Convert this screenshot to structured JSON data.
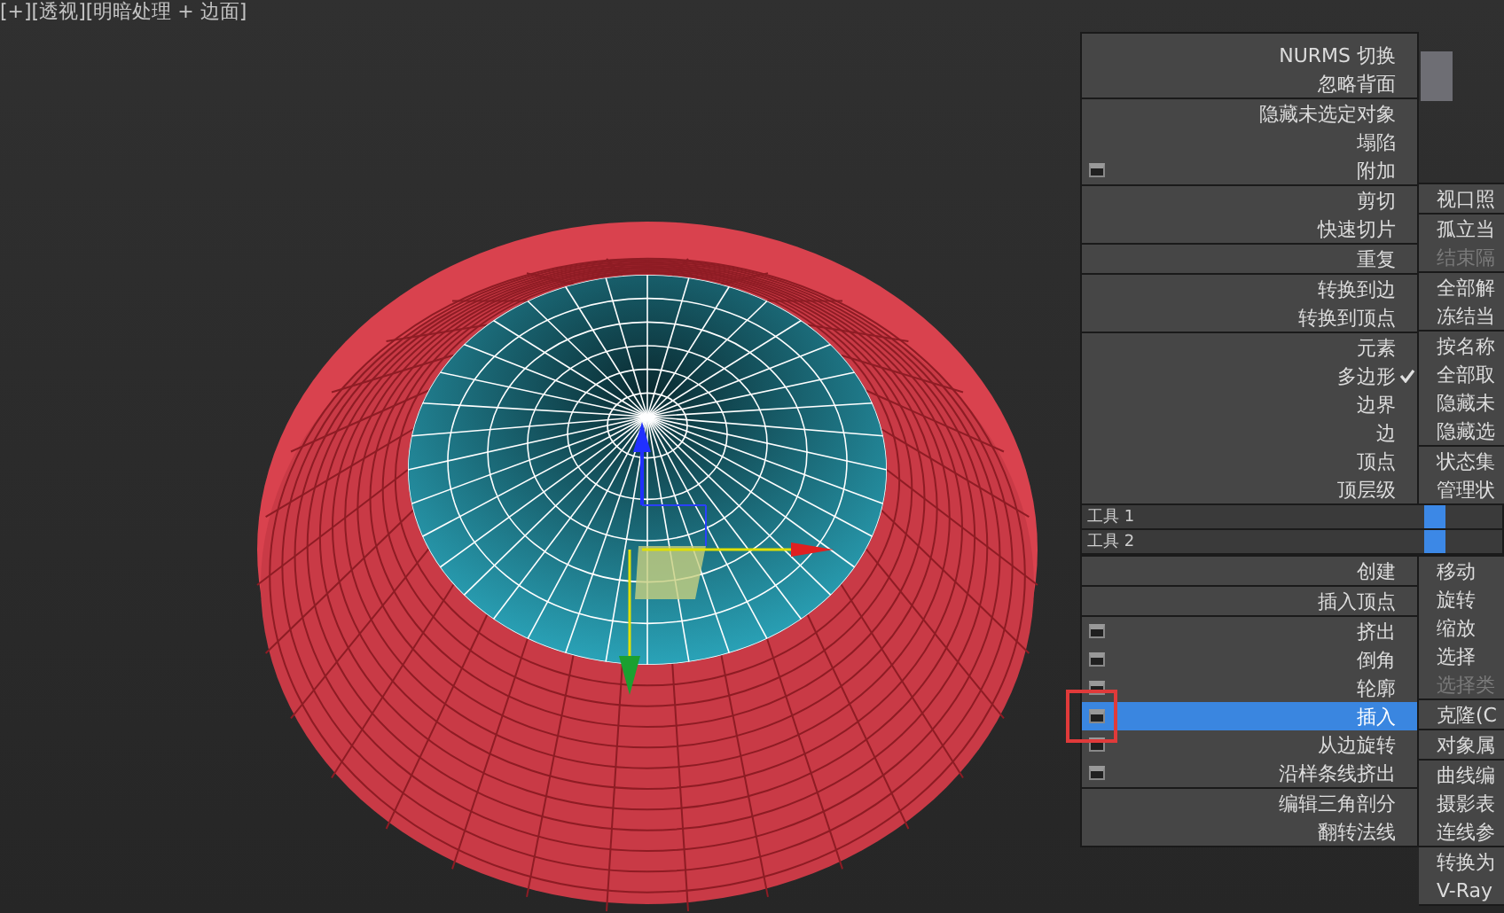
{
  "viewport": {
    "label": "[+][透视][明暗处理 + 边面]"
  },
  "quad_menu": {
    "left_top_groups": [
      {
        "items": [
          {
            "label": "NURMS 切换",
            "has_settings": false,
            "checked": false,
            "selected": false,
            "marked": false
          },
          {
            "label": "忽略背面",
            "has_settings": false,
            "checked": false,
            "selected": false,
            "marked": false
          }
        ]
      },
      {
        "items": [
          {
            "label": "隐藏未选定对象",
            "has_settings": false,
            "checked": false,
            "selected": false,
            "marked": false
          },
          {
            "label": "塌陷",
            "has_settings": false,
            "checked": false,
            "selected": false,
            "marked": false
          },
          {
            "label": "附加",
            "has_settings": true,
            "checked": false,
            "selected": false,
            "marked": false
          }
        ]
      },
      {
        "items": [
          {
            "label": "剪切",
            "has_settings": false,
            "checked": false,
            "selected": false,
            "marked": false
          },
          {
            "label": "快速切片",
            "has_settings": false,
            "checked": false,
            "selected": false,
            "marked": false
          }
        ]
      },
      {
        "items": [
          {
            "label": "重复",
            "has_settings": false,
            "checked": false,
            "selected": false,
            "marked": false
          }
        ]
      },
      {
        "items": [
          {
            "label": "转换到边",
            "has_settings": false,
            "checked": false,
            "selected": false,
            "marked": false
          },
          {
            "label": "转换到顶点",
            "has_settings": false,
            "checked": false,
            "selected": false,
            "marked": false
          }
        ]
      },
      {
        "items": [
          {
            "label": "元素",
            "has_settings": false,
            "checked": false,
            "selected": false,
            "marked": false
          },
          {
            "label": "多边形",
            "has_settings": false,
            "checked": true,
            "selected": false,
            "marked": false
          },
          {
            "label": "边界",
            "has_settings": false,
            "checked": false,
            "selected": false,
            "marked": false
          },
          {
            "label": "边",
            "has_settings": false,
            "checked": false,
            "selected": false,
            "marked": false
          },
          {
            "label": "顶点",
            "has_settings": false,
            "checked": false,
            "selected": false,
            "marked": false
          },
          {
            "label": "顶层级",
            "has_settings": false,
            "checked": false,
            "selected": false,
            "marked": false
          }
        ]
      }
    ],
    "right_top_groups": [
      {
        "items": [
          {
            "label": "视口照",
            "disabled": false
          }
        ]
      },
      {
        "items": [
          {
            "label": "孤立当",
            "disabled": false
          },
          {
            "label": "结束隔",
            "disabled": true
          }
        ]
      },
      {
        "items": [
          {
            "label": "全部解",
            "disabled": false
          },
          {
            "label": "冻结当",
            "disabled": false
          }
        ]
      },
      {
        "items": [
          {
            "label": "按名称",
            "disabled": false
          },
          {
            "label": "全部取",
            "disabled": false
          },
          {
            "label": "隐藏未",
            "disabled": false
          },
          {
            "label": "隐藏选",
            "disabled": false
          }
        ]
      },
      {
        "items": [
          {
            "label": "状态集",
            "disabled": false
          },
          {
            "label": "管理状",
            "disabled": false
          }
        ]
      }
    ],
    "tool_headers": [
      {
        "label": "工具 1"
      },
      {
        "label": "工具 2"
      }
    ],
    "left_bottom_groups": [
      {
        "items": [
          {
            "label": "创建",
            "has_settings": false,
            "checked": false,
            "selected": false,
            "marked": false
          }
        ]
      },
      {
        "items": [
          {
            "label": "插入顶点",
            "has_settings": false,
            "checked": false,
            "selected": false,
            "marked": false
          }
        ]
      },
      {
        "items": [
          {
            "label": "挤出",
            "has_settings": true,
            "checked": false,
            "selected": false,
            "marked": false
          },
          {
            "label": "倒角",
            "has_settings": true,
            "checked": false,
            "selected": false,
            "marked": false
          },
          {
            "label": "轮廓",
            "has_settings": true,
            "checked": false,
            "selected": false,
            "marked": false
          },
          {
            "label": "插入",
            "has_settings": true,
            "checked": false,
            "selected": true,
            "marked": true
          },
          {
            "label": "从边旋转",
            "has_settings": true,
            "checked": false,
            "selected": false,
            "marked": false
          },
          {
            "label": "沿样条线挤出",
            "has_settings": true,
            "checked": false,
            "selected": false,
            "marked": false
          }
        ]
      },
      {
        "items": [
          {
            "label": "编辑三角剖分",
            "has_settings": false,
            "checked": false,
            "selected": false,
            "marked": false
          },
          {
            "label": "翻转法线",
            "has_settings": false,
            "checked": false,
            "selected": false,
            "marked": false
          }
        ]
      }
    ],
    "right_bottom_groups": [
      {
        "items": [
          {
            "label": "移动",
            "disabled": false
          },
          {
            "label": "旋转",
            "disabled": false
          },
          {
            "label": "缩放",
            "disabled": false
          },
          {
            "label": "选择",
            "disabled": false
          },
          {
            "label": "选择类",
            "disabled": true
          }
        ]
      },
      {
        "items": [
          {
            "label": "克隆(C",
            "disabled": false
          }
        ]
      },
      {
        "items": [
          {
            "label": "对象属",
            "disabled": false
          }
        ]
      },
      {
        "items": [
          {
            "label": "曲线编",
            "disabled": false
          },
          {
            "label": "摄影表",
            "disabled": false
          },
          {
            "label": "连线参",
            "disabled": false
          }
        ]
      },
      {
        "items": [
          {
            "label": "转换为",
            "disabled": false
          },
          {
            "label": "V-Ray",
            "disabled": false
          }
        ]
      }
    ]
  }
}
